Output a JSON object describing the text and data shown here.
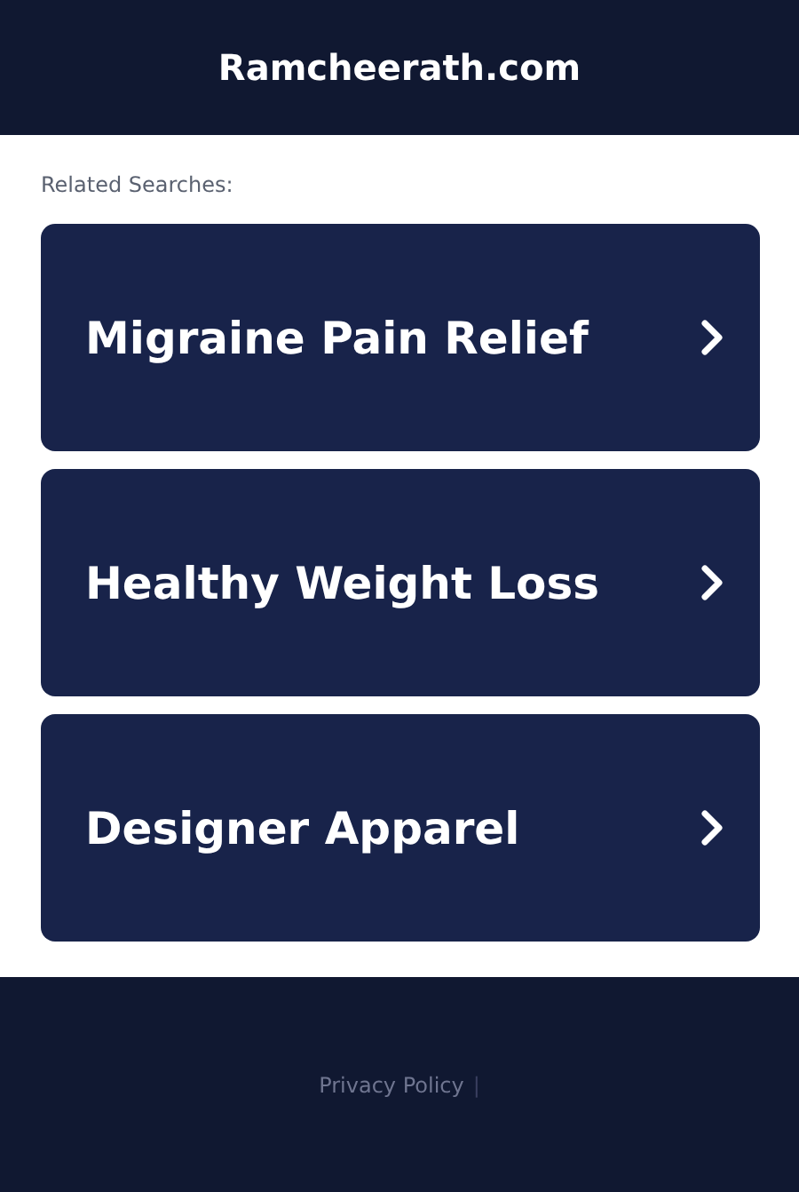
{
  "header": {
    "title": "Ramcheerath.com"
  },
  "related": {
    "heading": "Related Searches:",
    "links": [
      {
        "label": "Migraine Pain Relief"
      },
      {
        "label": "Healthy Weight Loss"
      },
      {
        "label": "Designer Apparel"
      }
    ]
  },
  "footer": {
    "links": [
      "Privacy Policy"
    ],
    "separator": "|"
  }
}
